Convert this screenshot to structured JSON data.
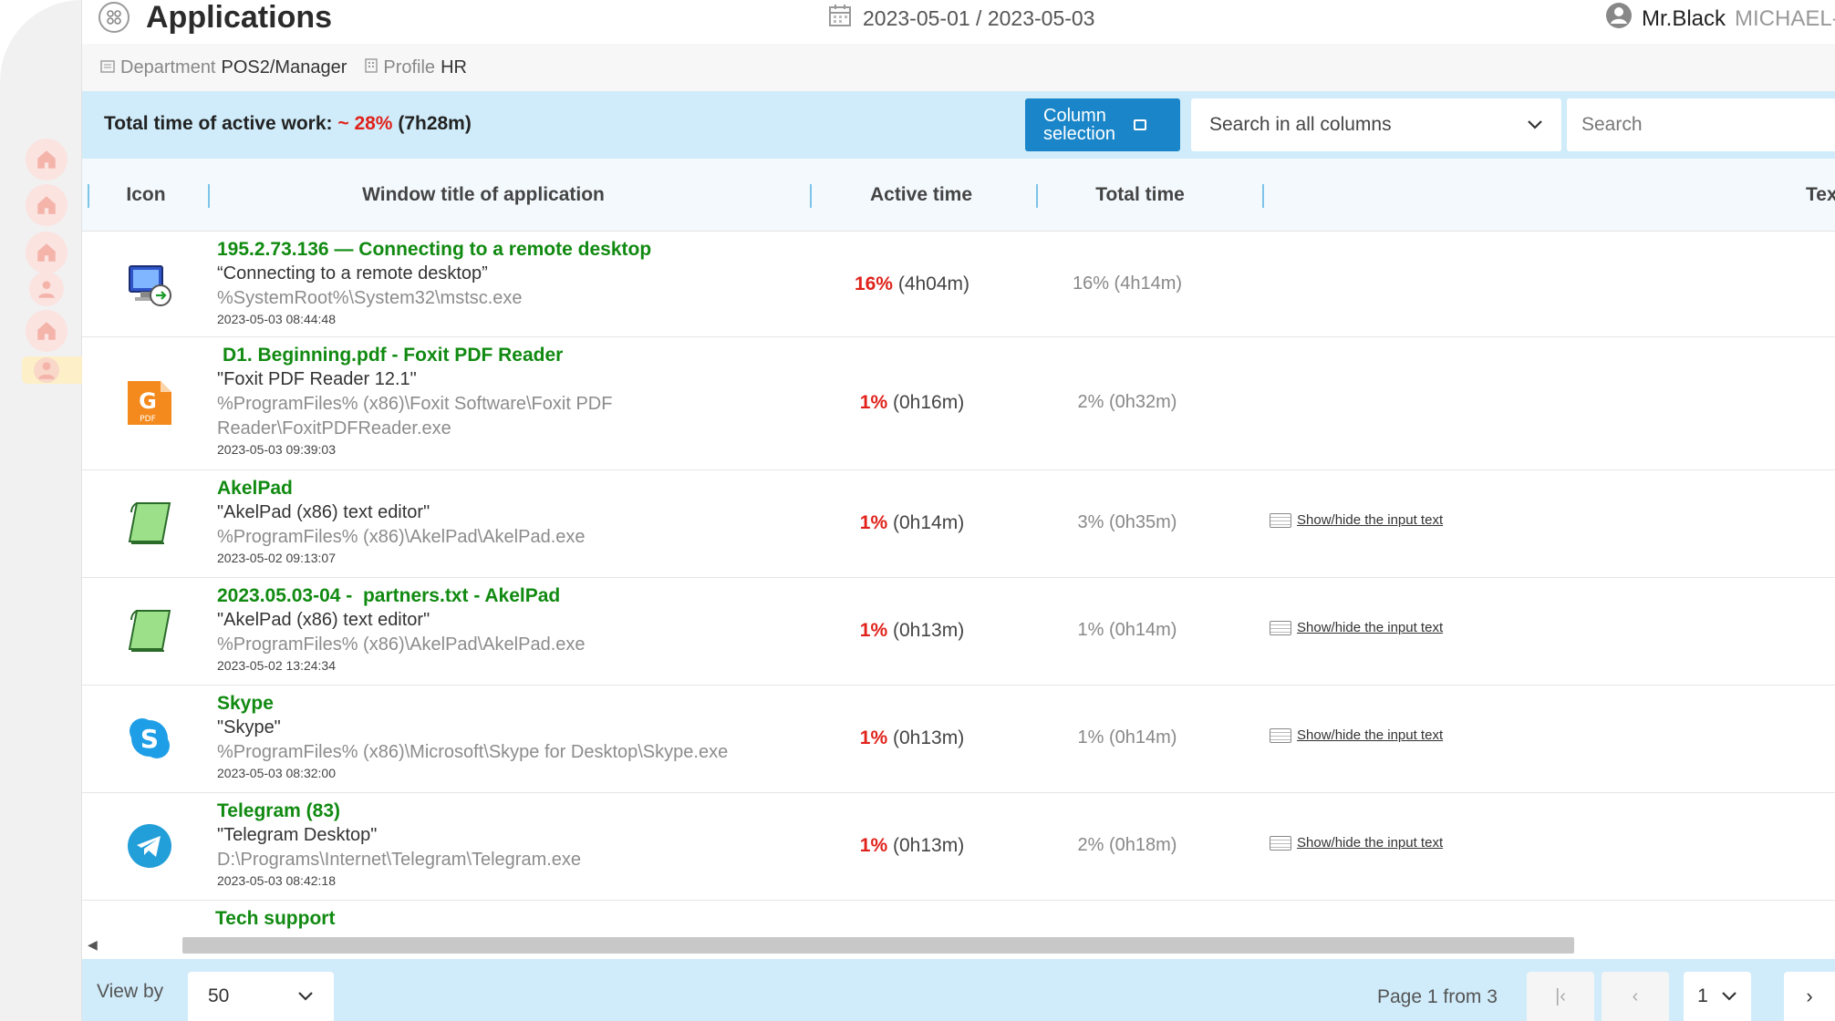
{
  "header": {
    "title": "Applications",
    "date_range": "2023-05-01 / 2023-05-03",
    "user_name": "Mr.Black",
    "user_id": "MICHAEL-"
  },
  "subheader": {
    "department_label": "Department",
    "department_value": "POS2/Manager",
    "profile_label": "Profile",
    "profile_value": "HR"
  },
  "toolbar": {
    "total_label": "Total time of active work:",
    "total_tilde": "~",
    "total_pct": "28%",
    "total_time": "(7h28m)",
    "column_selection_line1": "Column",
    "column_selection_line2": "selection",
    "search_scope": "Search in all columns",
    "search_placeholder": "Search"
  },
  "columns": {
    "icon": "Icon",
    "window_title": "Window title of application",
    "active_time": "Active time",
    "total_time": "Total time",
    "text": "Tex"
  },
  "rows": [
    {
      "icon": "remote-desktop-icon",
      "title": "195.2.73.136 — Connecting to a remote desktop",
      "desc": "“Connecting to a remote desktop”",
      "path": "%SystemRoot%\\System32\\mstsc.exe",
      "date": "2023-05-03 08:44:48",
      "active_pct": "16%",
      "active_time": "(4h04m)",
      "total": "16% (4h14m)",
      "show_text": ""
    },
    {
      "icon": "foxit-pdf-icon",
      "title": "D1. Beginning.pdf - Foxit PDF Reader",
      "desc": "\"Foxit PDF Reader 12.1\"",
      "path": "%ProgramFiles% (x86)\\Foxit Software\\Foxit PDF Reader\\FoxitPDFReader.exe",
      "date": "2023-05-03 09:39:03",
      "active_pct": "1%",
      "active_time": "(0h16m)",
      "total": "2% (0h32m)",
      "show_text": ""
    },
    {
      "icon": "akelpad-icon",
      "title": "AkelPad",
      "desc": "\"AkelPad (x86) text editor\"",
      "path": "%ProgramFiles% (x86)\\AkelPad\\AkelPad.exe",
      "date": "2023-05-02 09:13:07",
      "active_pct": "1%",
      "active_time": "(0h14m)",
      "total": "3% (0h35m)",
      "show_text": "Show/hide the input text"
    },
    {
      "icon": "akelpad-icon",
      "title": "2023.05.03-04 -  partners.txt - AkelPad",
      "desc": "\"AkelPad (x86) text editor\"",
      "path": "%ProgramFiles% (x86)\\AkelPad\\AkelPad.exe",
      "date": "2023-05-02 13:24:34",
      "active_pct": "1%",
      "active_time": "(0h13m)",
      "total": "1% (0h14m)",
      "show_text": "Show/hide the input text"
    },
    {
      "icon": "skype-icon",
      "title": "Skype",
      "desc": "\"Skype\"",
      "path": "%ProgramFiles% (x86)\\Microsoft\\Skype for Desktop\\Skype.exe",
      "date": "2023-05-03 08:32:00",
      "active_pct": "1%",
      "active_time": "(0h13m)",
      "total": "1% (0h14m)",
      "show_text": "Show/hide the input text"
    },
    {
      "icon": "telegram-icon",
      "title": "Telegram (83)",
      "desc": "\"Telegram Desktop\"",
      "path": "D:\\Programs\\Internet\\Telegram\\Telegram.exe",
      "date": "2023-05-03 08:42:18",
      "active_pct": "1%",
      "active_time": "(0h13m)",
      "total": "2% (0h18m)",
      "show_text": "Show/hide the input text"
    },
    {
      "icon": "generic-app-icon",
      "title": "Tech support",
      "desc": "",
      "path": "",
      "date": "",
      "active_pct": "",
      "active_time": "",
      "total": "",
      "show_text": ""
    }
  ],
  "footer": {
    "view_by_label": "View by",
    "view_by_value": "50",
    "page_info": "Page 1 from 3",
    "page_first": "|‹",
    "page_prev": "‹",
    "page_select": "1",
    "page_next": "›"
  },
  "colors": {
    "accent_blue": "#1a86c9",
    "toolbar_bg": "#d0ecfa",
    "title_green": "#118a11",
    "percent_red": "#e0221b"
  }
}
